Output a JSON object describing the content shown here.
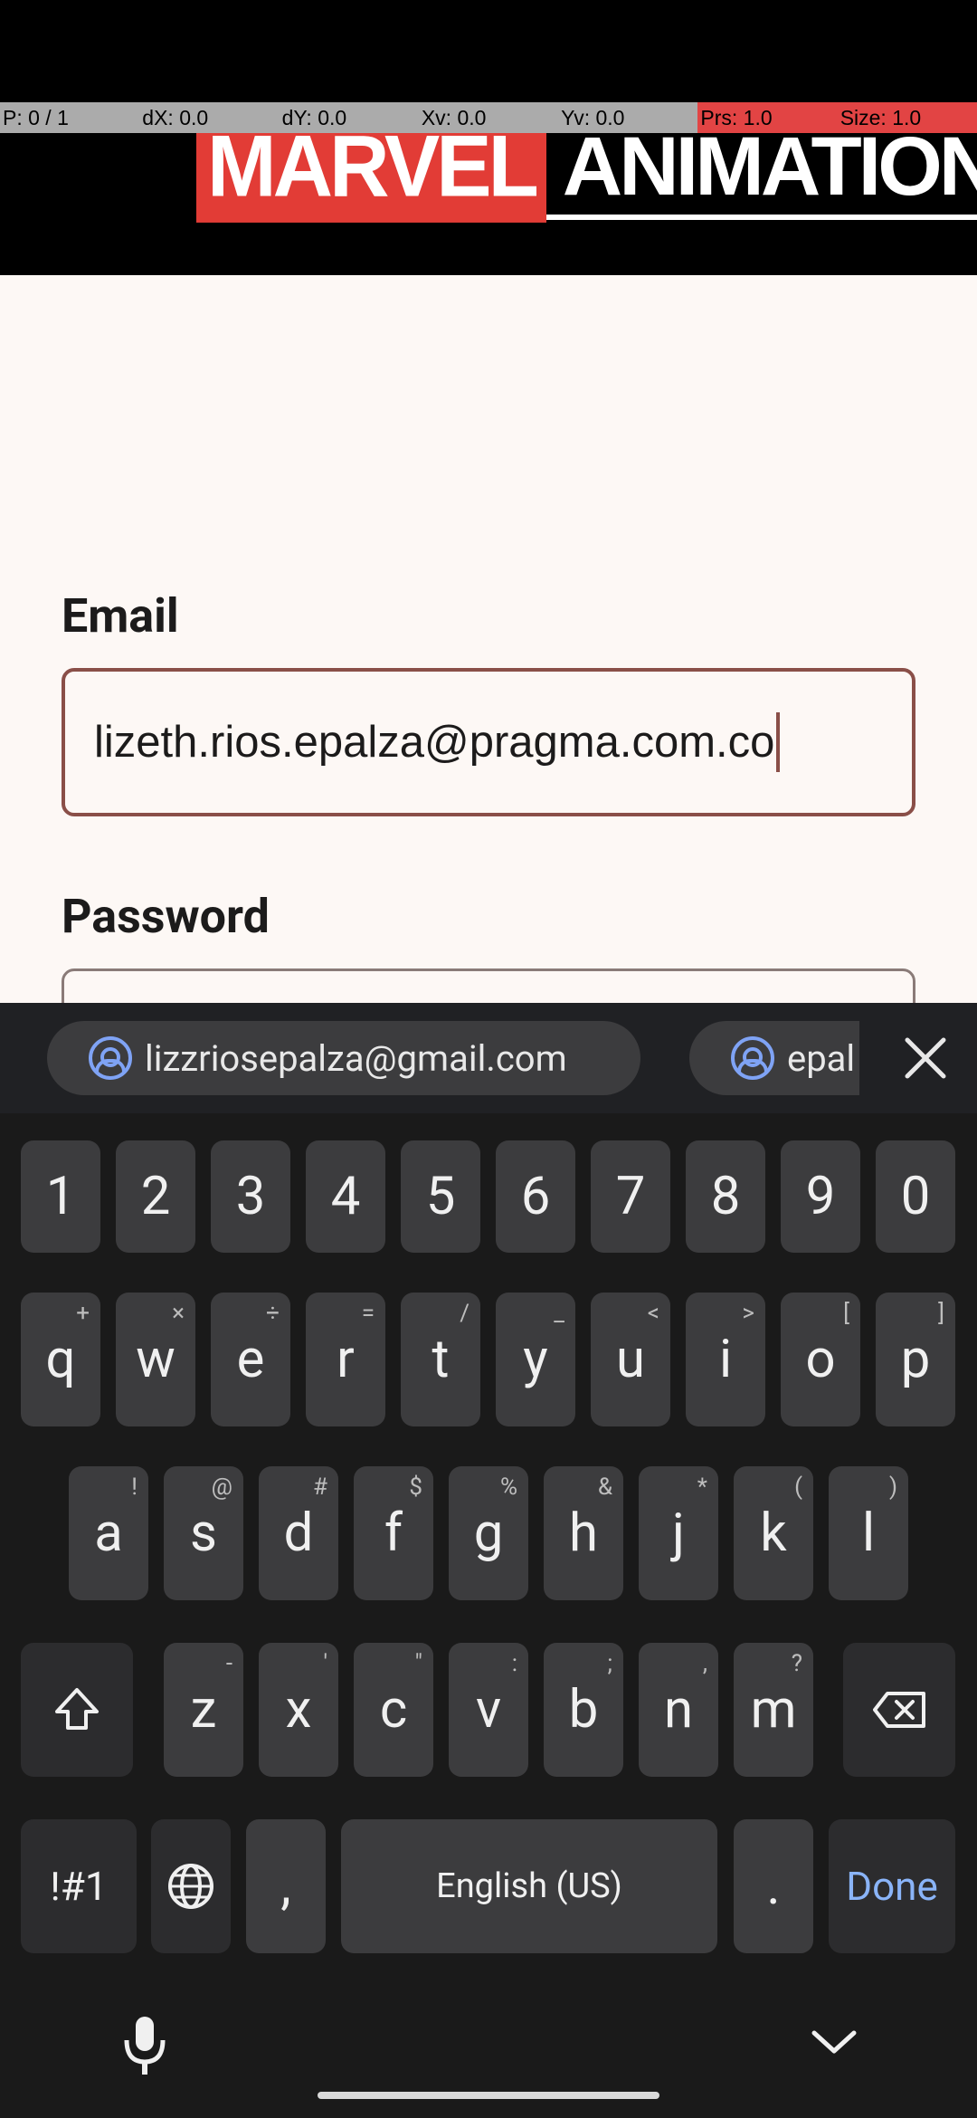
{
  "debug": {
    "pointer": "P: 0 / 1",
    "dx": "dX: 0.0",
    "dy": "dY: 0.0",
    "xv": "Xv: 0.0",
    "yv": "Yv: 0.0",
    "prs": "Prs: 1.0",
    "size": "Size: 1.0"
  },
  "header": {
    "logo_left": "MARVEL",
    "logo_right": "ANIMATION",
    "logo_colors": {
      "marvel_bg": "#e23c36",
      "text": "#ffffff"
    }
  },
  "form": {
    "email_label": "Email",
    "email_value": "lizeth.rios.epalza@pragma.com.co",
    "password_label": "Password",
    "password_value": ""
  },
  "keyboard": {
    "suggestions": [
      "lizzriosepalza@gmail.com",
      "epal"
    ],
    "numbers": [
      "1",
      "2",
      "3",
      "4",
      "5",
      "6",
      "7",
      "8",
      "9",
      "0"
    ],
    "row1": [
      [
        "q",
        "+"
      ],
      [
        "w",
        "×"
      ],
      [
        "e",
        "÷"
      ],
      [
        "r",
        "="
      ],
      [
        "t",
        "/"
      ],
      [
        "y",
        "_"
      ],
      [
        "u",
        "<"
      ],
      [
        "i",
        ">"
      ],
      [
        "o",
        "["
      ],
      [
        "p",
        "]"
      ]
    ],
    "row2": [
      [
        "a",
        "!"
      ],
      [
        "s",
        "@"
      ],
      [
        "d",
        "#"
      ],
      [
        "f",
        "$"
      ],
      [
        "g",
        "%"
      ],
      [
        "h",
        "&"
      ],
      [
        "j",
        "*"
      ],
      [
        "k",
        "("
      ],
      [
        "l",
        ")"
      ]
    ],
    "row3": [
      [
        "z",
        "-"
      ],
      [
        "x",
        "'"
      ],
      [
        "c",
        "\""
      ],
      [
        "v",
        ":"
      ],
      [
        "b",
        ";"
      ],
      [
        "n",
        ","
      ],
      [
        "m",
        "?"
      ]
    ],
    "symbols_label": "!#1",
    "comma_label": ",",
    "space_label": "English (US)",
    "period_label": ".",
    "done_label": "Done",
    "accent_color": "#8ab4f8"
  }
}
